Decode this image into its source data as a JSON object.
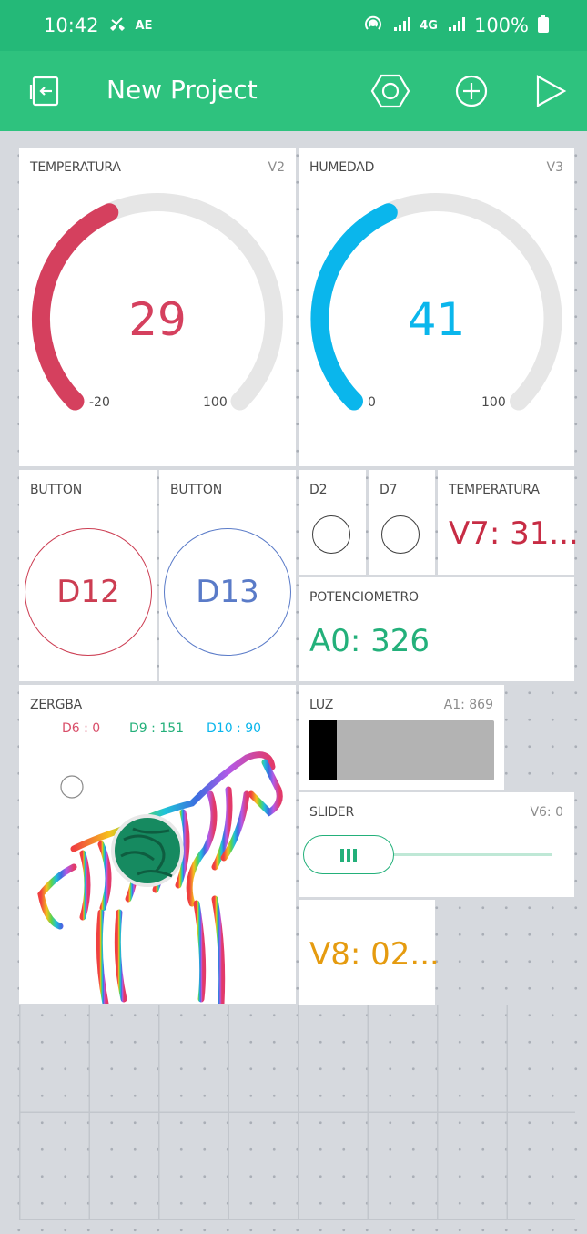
{
  "status_bar": {
    "time": "10:42",
    "left_icons": [
      "missed-call-icon",
      "translate-icon"
    ],
    "ae": "AE",
    "hd": "4G",
    "battery": "100%"
  },
  "app_bar": {
    "title": "New Project"
  },
  "colors": {
    "green": "#2ec27e",
    "red": "#d5405e",
    "blue": "#0ab6ec",
    "navy": "#5b77c7",
    "teal": "#23b07a",
    "orange": "#e59b0f",
    "purple": "#c72c44"
  },
  "gauges": [
    {
      "label": "TEMPERATURA",
      "pin": "V2",
      "value": "29",
      "min": "-20",
      "max": "100",
      "fraction": 0.41,
      "color": "#d5405e"
    },
    {
      "label": "HUMEDAD",
      "pin": "V3",
      "value": "41",
      "min": "0",
      "max": "100",
      "fraction": 0.41,
      "color": "#0ab6ec"
    }
  ],
  "buttons": [
    {
      "label": "BUTTON",
      "pin_text": "D12",
      "color": "#cc3d52"
    },
    {
      "label": "BUTTON",
      "pin_text": "D13",
      "color": "#5a7bc8"
    }
  ],
  "leds": [
    {
      "label": "D2"
    },
    {
      "label": "D7"
    }
  ],
  "value_displays": {
    "temp_v7": {
      "label": "TEMPERATURA",
      "value": "V7: 31..."
    },
    "pot": {
      "label": "POTENCIOMETRO",
      "value": "A0: 326"
    },
    "v8": {
      "value": "V8: 02..."
    }
  },
  "zergba": {
    "label": "ZERGBA",
    "channels": [
      {
        "text": "D6 : 0",
        "color": "#d94f6a"
      },
      {
        "text": "D9 : 151",
        "color": "#23b07a"
      },
      {
        "text": "D10 : 90",
        "color": "#0ab6ec"
      }
    ]
  },
  "luz": {
    "label": "LUZ",
    "pin": "A1: 869",
    "level_fraction": 0.15
  },
  "slider": {
    "label": "SLIDER",
    "pin": "V6: 0",
    "value_fraction": 0.0
  }
}
